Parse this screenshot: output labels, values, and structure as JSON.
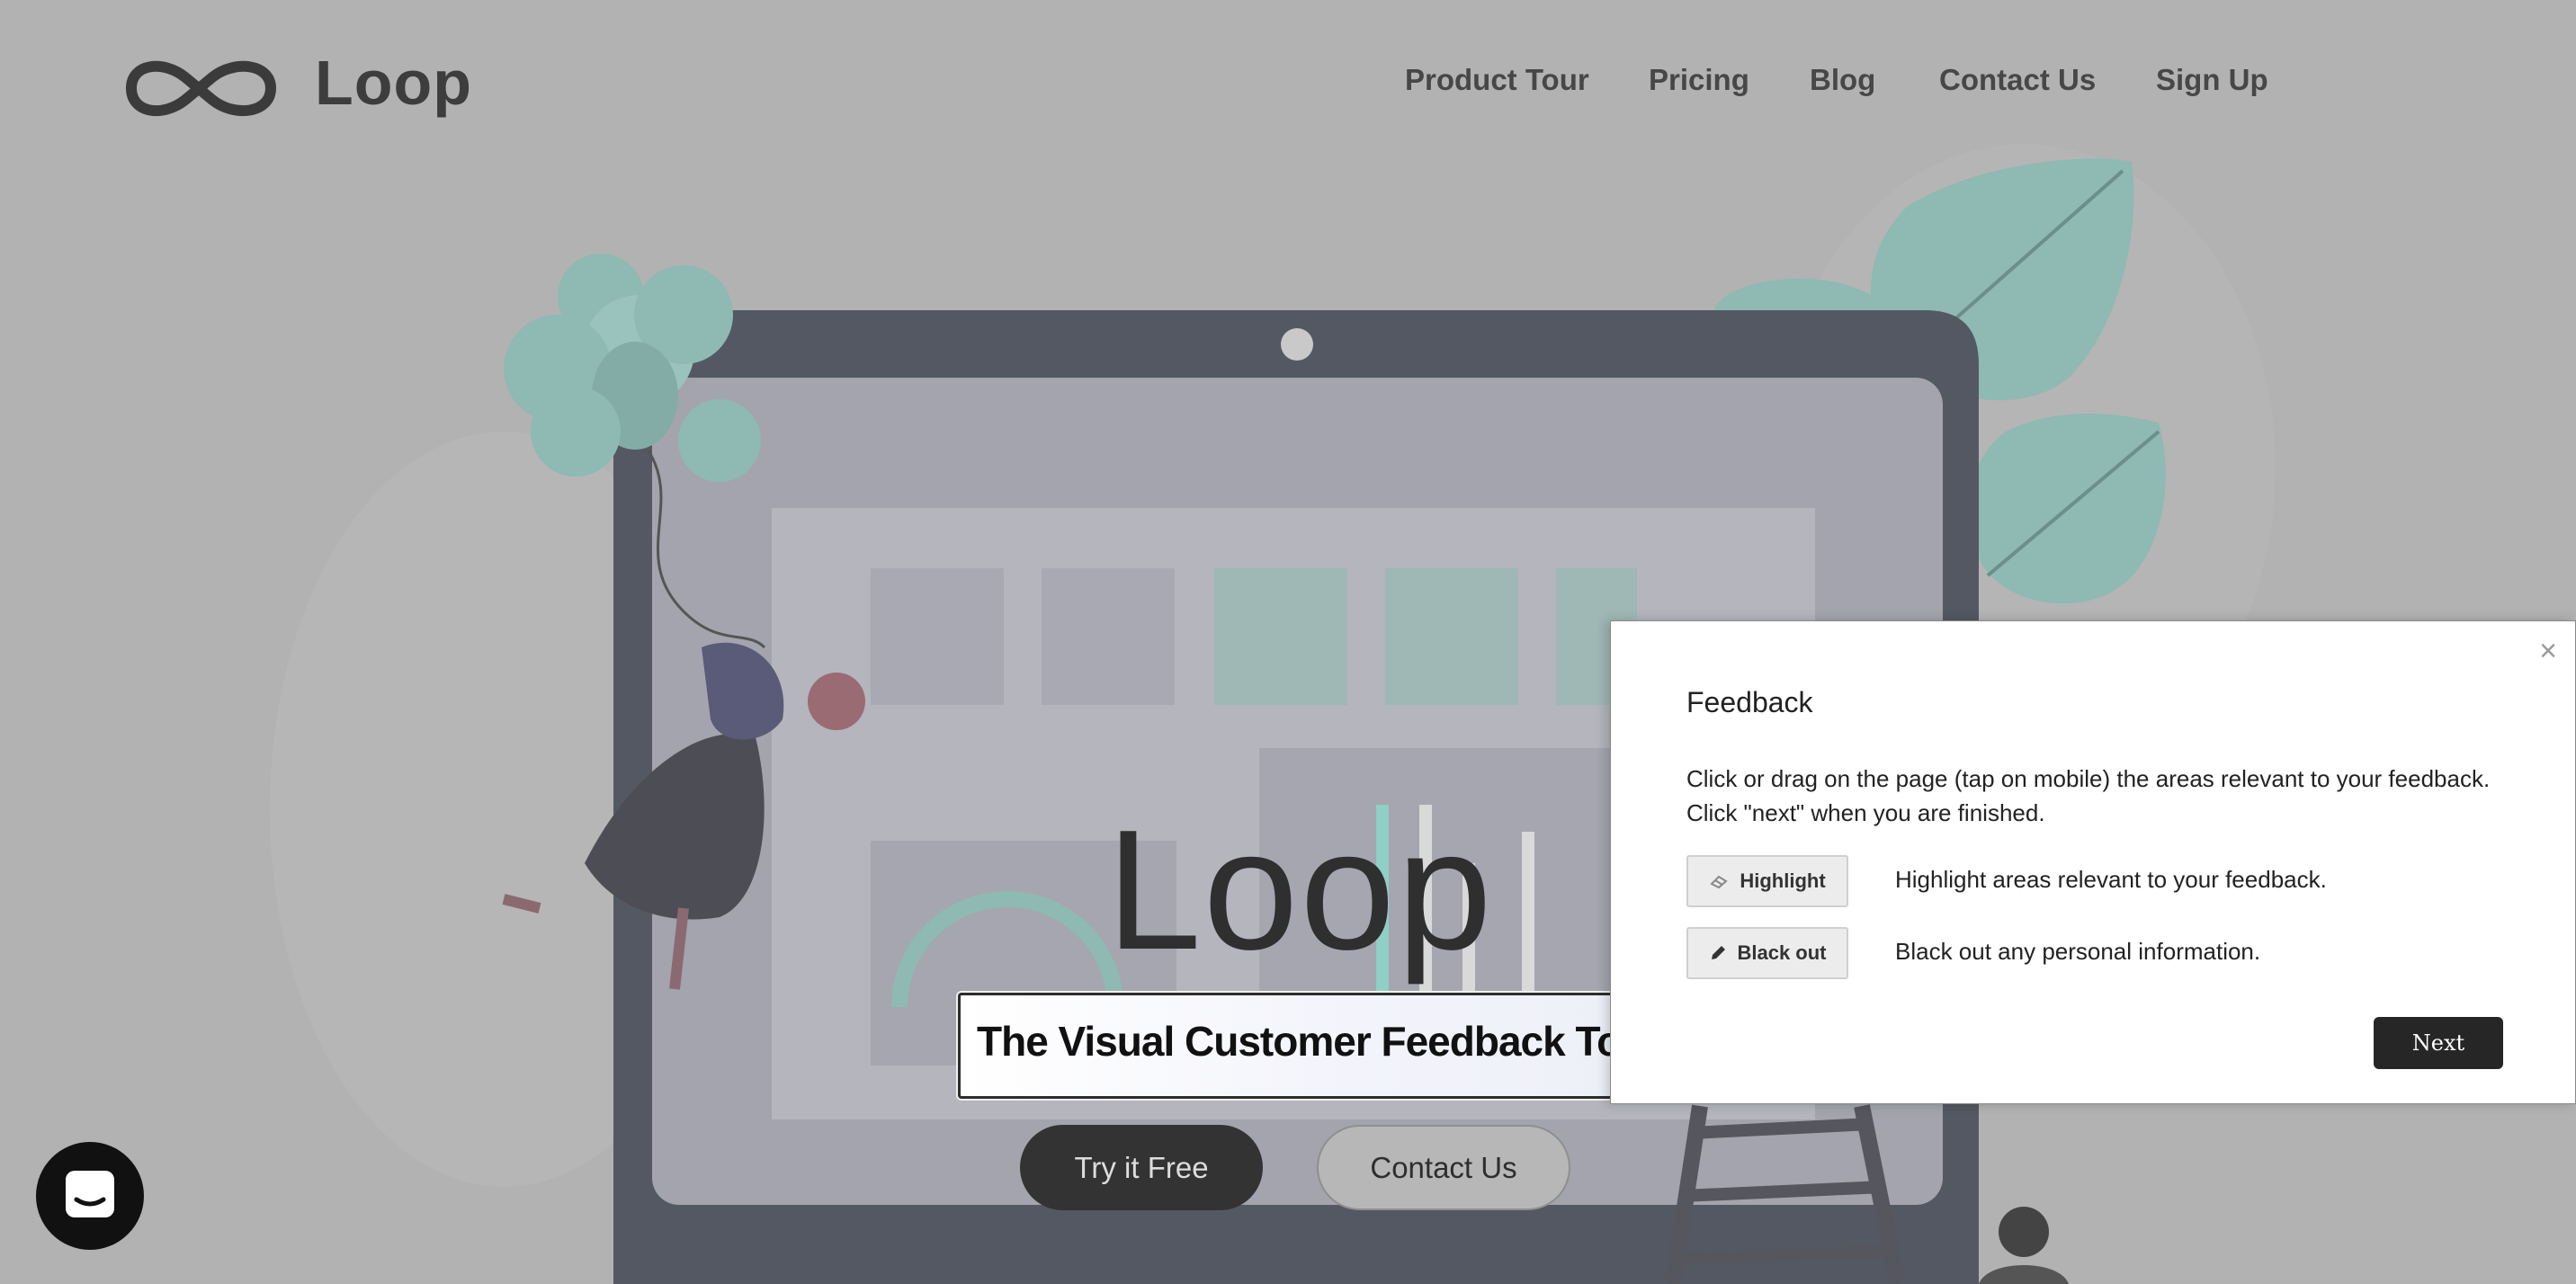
{
  "header": {
    "brand": "Loop",
    "nav": [
      "Product Tour",
      "Pricing",
      "Blog",
      "Contact Us",
      "Sign Up"
    ]
  },
  "hero": {
    "title": "Loop",
    "subtitle": "The Visual Customer Feedback Tool",
    "primary_button": "Try it Free",
    "secondary_button": "Contact Us"
  },
  "feedback_panel": {
    "close_label": "×",
    "title": "Feedback",
    "description_line1": "Click or drag on the page (tap on mobile) the areas relevant to your feedback.",
    "description_line2": "Click \"next\" when you are finished.",
    "tools": [
      {
        "label": "Highlight",
        "icon": "eraser-icon",
        "description": "Highlight areas relevant to your feedback."
      },
      {
        "label": "Black out",
        "icon": "pencil-icon",
        "description": "Black out any personal information."
      }
    ],
    "next_label": "Next"
  },
  "chat_widget": {
    "icon": "chat-icon"
  },
  "colors": {
    "overlay_background": "#b2b2b2",
    "accent_teal": "#8fb9b3",
    "laptop_frame": "#545862",
    "dark_button": "#333333"
  }
}
